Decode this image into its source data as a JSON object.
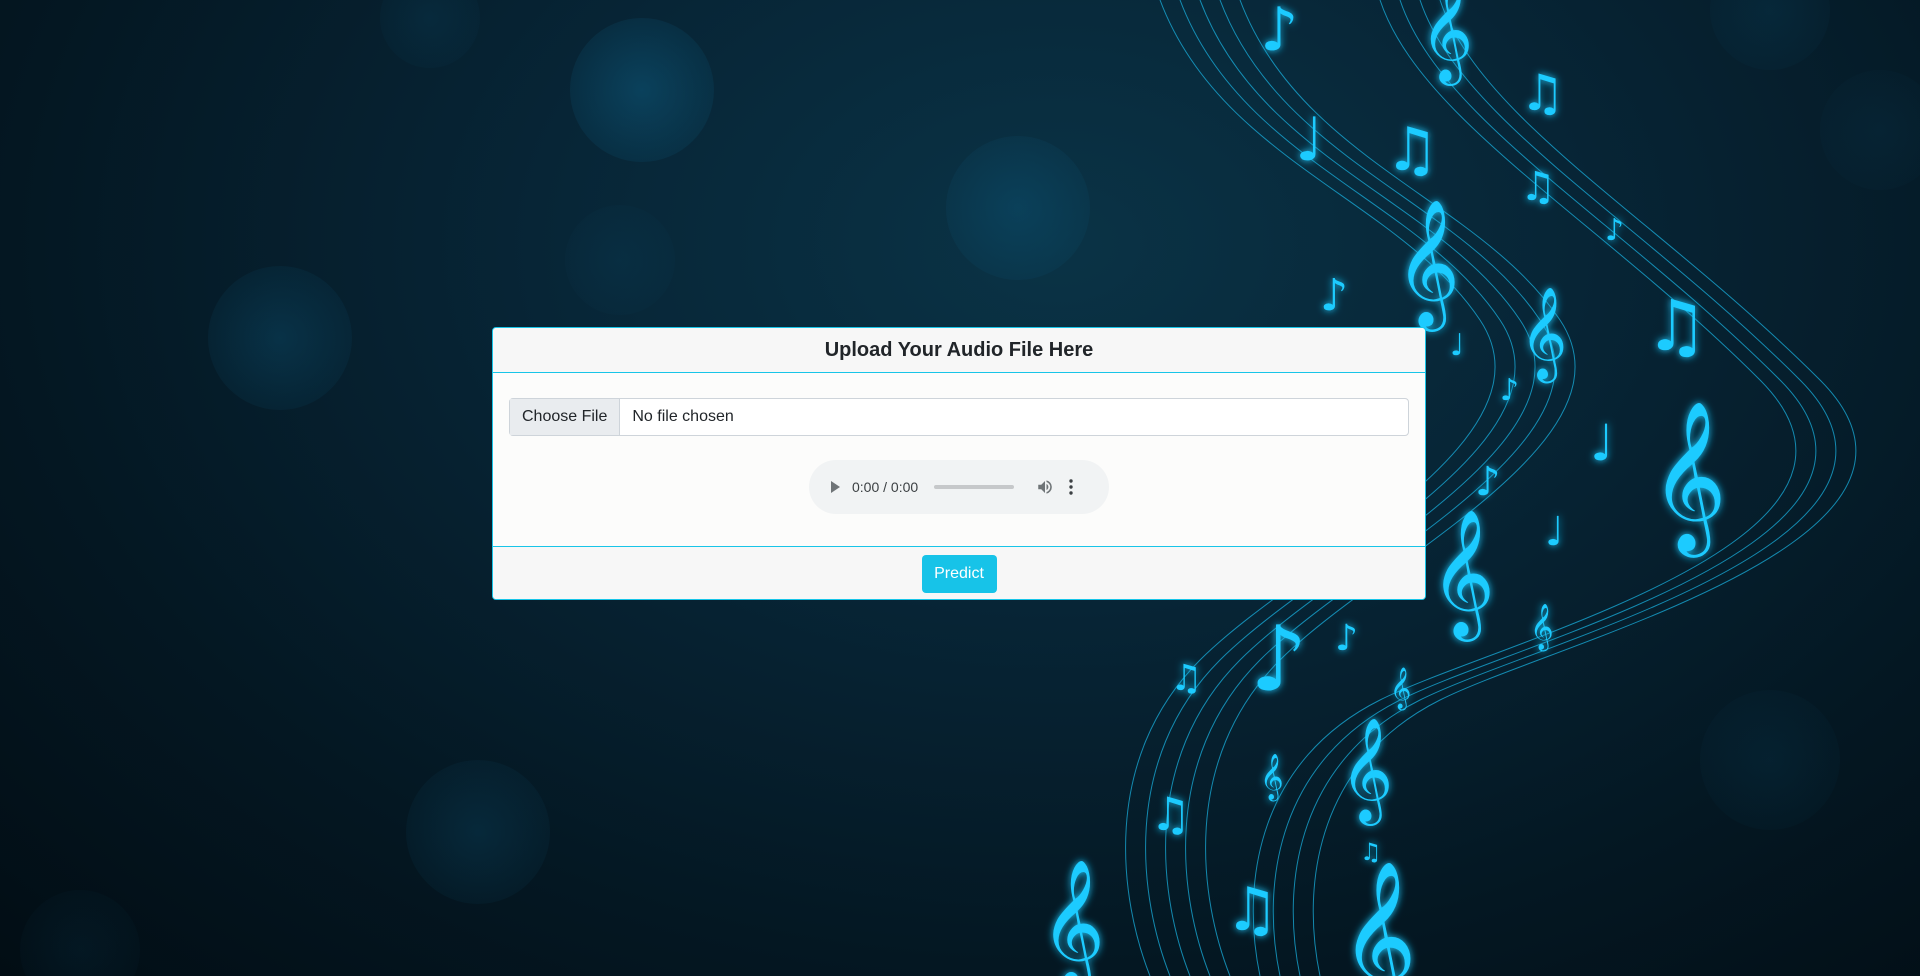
{
  "colors": {
    "accent": "#17c3e8",
    "border": "#18c5e8",
    "background_dark": "#041722",
    "notes": "#1ec9ff"
  },
  "background": {
    "description_icon": "music-notes-icon"
  },
  "upload_card": {
    "title": "Upload Your Audio File Here",
    "file_input": {
      "button_label": "Choose File",
      "status_text": "No file chosen"
    },
    "audio_player": {
      "time_display": "0:00 / 0:00",
      "play_icon": "play-icon",
      "volume_icon": "volume-icon",
      "menu_icon": "more-vertical-icon"
    },
    "predict_label": "Predict"
  }
}
